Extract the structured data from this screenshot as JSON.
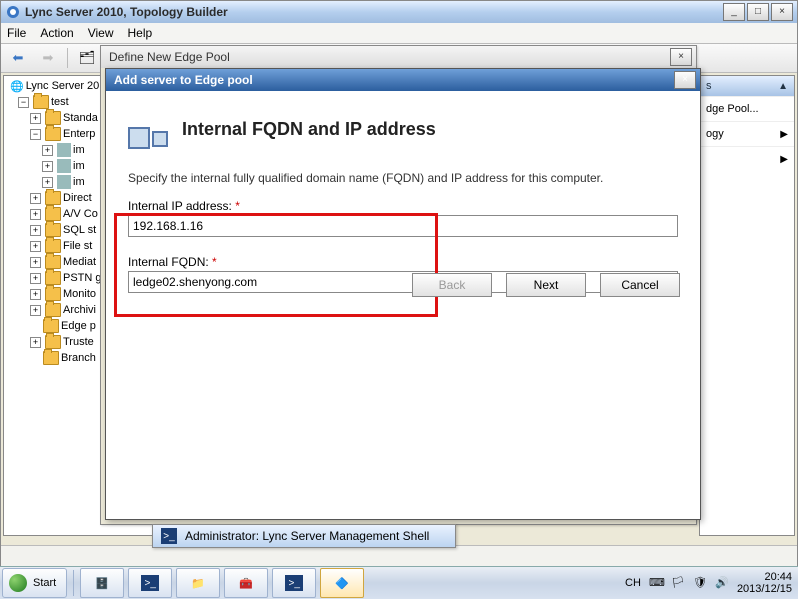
{
  "main_window": {
    "title": "Lync Server 2010, Topology Builder",
    "menu": {
      "file": "File",
      "action": "Action",
      "view": "View",
      "help": "Help"
    }
  },
  "tree": {
    "root": "Lync Server 20",
    "site": "test",
    "items": [
      "Standa",
      "Enterp",
      "im",
      "im",
      "im",
      "Direct",
      "A/V Co",
      "SQL st",
      "File st",
      "Mediat",
      "PSTN g",
      "Monito",
      "Archivi",
      "Edge p",
      "Truste",
      "Branch"
    ]
  },
  "right_panel": {
    "header": "s",
    "items": [
      "dge Pool...",
      "ogy"
    ]
  },
  "modal1": {
    "title": "Define New Edge Pool"
  },
  "modal2": {
    "title": "Add server to Edge pool",
    "heading": "Internal FQDN and IP address",
    "desc": "Specify the internal fully qualified domain name (FQDN) and IP address for this computer.",
    "ip_label": "Internal IP address:",
    "ip_value": "192.168.1.16",
    "fqdn_label": "Internal FQDN:",
    "fqdn_value": "ledge02.shenyong.com",
    "back": "Back",
    "next": "Next",
    "cancel": "Cancel"
  },
  "admin_shell": "Administrator: Lync Server Management Shell",
  "taskbar": {
    "start": "Start",
    "lang": "CH",
    "time": "20:44",
    "date": "2013/12/15"
  }
}
